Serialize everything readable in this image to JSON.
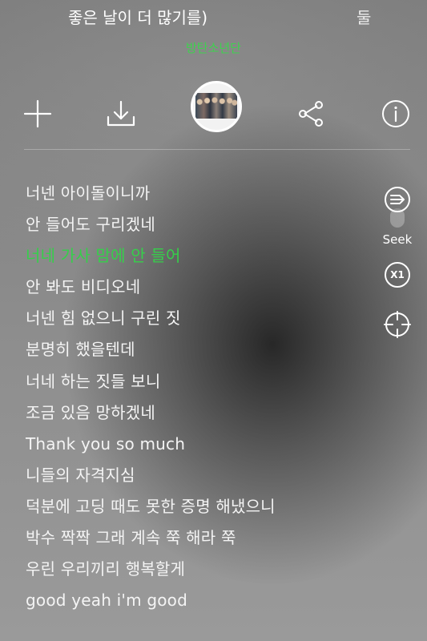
{
  "header": {
    "title": "좋은 날이 더 많기를)",
    "next_title_fragment": "둘",
    "artist": "방탄소년단"
  },
  "toolbar": {
    "icons": [
      "add-icon",
      "download-icon",
      "album-art",
      "share-icon",
      "info-icon"
    ]
  },
  "lyrics": {
    "active_index": 2,
    "lines": [
      "너넨 아이돌이니까",
      "안 들어도 구리겠네",
      "너네 가사 맘에 안 들어",
      "안 봐도 비디오네",
      "너넨 힘 없으니 구린 짓",
      "분명히 했을텐데",
      "너네 하는 짓들 보니",
      "조금 있음 망하겠네",
      "Thank you so much",
      "니들의 자격지심",
      "덕분에 고딩 때도 못한 증명 해냈으니",
      "박수 짝짝 그래 계속 쭉 해라 쭉",
      "우린 우리끼리 행복할게",
      "good yeah i'm good"
    ]
  },
  "side_controls": {
    "seek_label": "Seek",
    "speed_label": "X1"
  },
  "colors": {
    "accent": "#35d04a",
    "text": "#ffffff"
  }
}
